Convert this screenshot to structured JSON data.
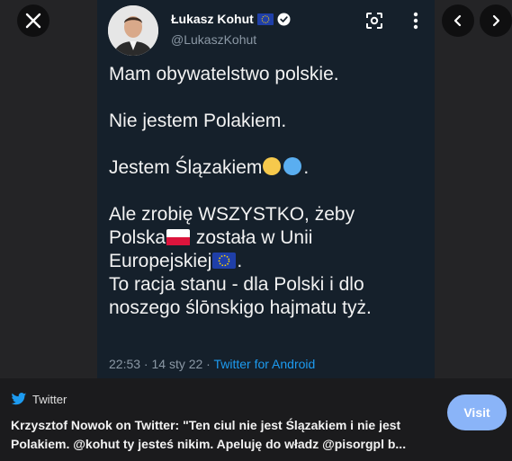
{
  "tweet": {
    "display_name": "Łukasz Kohut",
    "handle": "@LukaszKohut",
    "lines": {
      "l1": "Mam obywatelstwo polskie.",
      "l2": "Nie jestem Polakiem.",
      "l3": "Jestem Ślązakiem",
      "l3_end": ".",
      "l4": "Ale zrobię WSZYSTKO, żeby",
      "l5a": "Polska",
      "l5b": " została w Unii",
      "l6a": "Europejskiej",
      "l6b": ".",
      "l7": "To racja stanu - dla Polski i dlo",
      "l8": "noszego ślōnskigo hajmatu tyż."
    },
    "timestamp": "22:53 · 14 sty 22 · ",
    "source": "Twitter for Android"
  },
  "card": {
    "site_name": "Twitter",
    "title": "Krzysztof Nowok on Twitter: \"Ten ciul nie jest Ślązakiem i nie jest Polakiem. @kohut ty jesteś nikim. Apeluję do władz @pisorgpl b...",
    "visit_label": "Visit"
  },
  "icons": {
    "close": "close-icon",
    "prev": "chevron-left-icon",
    "next": "chevron-right-icon",
    "lens": "lens-search-icon",
    "more": "more-vert-icon",
    "verified": "verified-badge-icon",
    "eu_flag": "eu-flag-icon",
    "pl_flag": "poland-flag-icon",
    "twitter": "twitter-bird-icon"
  },
  "colors": {
    "tweet_bg": "#15202b",
    "link_blue": "#1d9bf0",
    "visit_btn": "#8ab4f8"
  }
}
